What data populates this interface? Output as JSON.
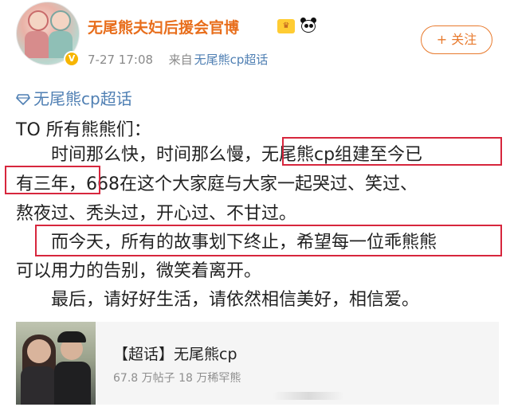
{
  "header": {
    "username": "无尾熊夫妇后援会官博",
    "time": "7-27 17:08",
    "source_prefix": "来自",
    "source": "无尾熊cp超话",
    "follow_label": "+ 关注",
    "vip_badge": "V"
  },
  "topic": {
    "label": "无尾熊cp超话"
  },
  "post": {
    "lines": [
      "TO 所有熊熊们：",
      "　　时间那么快，时间那么慢，无尾熊cp组建至今已",
      "有三年，668在这个大家庭与大家一起哭过、笑过、",
      "熬夜过、秃头过，开心过、不甘过。",
      "　　而今天，所有的故事划下终止，希望每一位乖熊熊",
      "可以用力的告别，微笑着离开。",
      "　　最后，请好好生活，请依然相信美好，相信爱。"
    ]
  },
  "card": {
    "title": "【超话】无尾熊cp",
    "stats": "67.8 万帖子  18 万稀罕熊"
  },
  "colors": {
    "username": "#e86e1c",
    "link": "#4f7fb3",
    "highlight_box": "#d7263d",
    "follow": "#e87a2d"
  }
}
